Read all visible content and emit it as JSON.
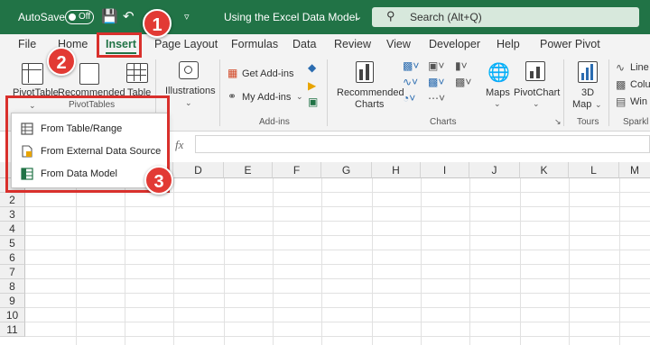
{
  "titlebar": {
    "autosave_label": "AutoSave",
    "autosave_state": "Off",
    "doc_title": "Using the Excel Data Model",
    "search_placeholder": "Search (Alt+Q)"
  },
  "tabs": [
    "File",
    "Home",
    "Insert",
    "Page Layout",
    "Formulas",
    "Data",
    "Review",
    "View",
    "Developer",
    "Help",
    "Power Pivot"
  ],
  "active_tab": "Insert",
  "ribbon": {
    "pivottable": "PivotTable",
    "recommended": "Recommended",
    "table": "Table",
    "pivottables_group": "PivotTables",
    "illustrations": "Illustrations",
    "get_addins": "Get Add-ins",
    "my_addins": "My Add-ins",
    "addins_group": "Add-ins",
    "recommended_charts_1": "Recommended",
    "recommended_charts_2": "Charts",
    "charts_group": "Charts",
    "maps": "Maps",
    "pivotchart": "PivotChart",
    "map3d_1": "3D",
    "map3d_2": "Map",
    "tours_group": "Tours",
    "sparklines_group": "Sparkl",
    "line": "Line",
    "column": "Colu",
    "winloss": "Win"
  },
  "formula_bar": {
    "fx": "fx"
  },
  "columns": [
    "D",
    "E",
    "F",
    "G",
    "H",
    "I",
    "J",
    "K",
    "L",
    "M"
  ],
  "rows": [
    "2",
    "3",
    "4",
    "5",
    "6",
    "7",
    "8",
    "9",
    "10",
    "11"
  ],
  "menu": {
    "items": [
      "From Table/Range",
      "From External Data Source",
      "From Data Model"
    ]
  },
  "callouts": [
    "1",
    "2",
    "3"
  ],
  "colors": {
    "excel_green": "#217346",
    "callout_red": "#e23a34"
  }
}
